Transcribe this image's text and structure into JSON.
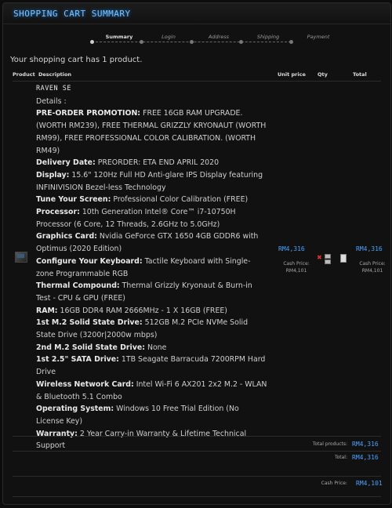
{
  "header": {
    "title": "SHOPPING CART SUMMARY"
  },
  "steps": [
    "Summary",
    "Login",
    "Address",
    "Shipping",
    "Payment"
  ],
  "cart_message": "Your shopping cart has 1 product.",
  "table_headers": {
    "product": "Product",
    "description": "Description",
    "unit_price": "Unit price",
    "qty": "Qty",
    "total": "Total"
  },
  "product": {
    "name": "RAVEN SE",
    "details_label": "Details :",
    "specs": [
      {
        "label": "PRE-ORDER PROMOTION:",
        "value": "FREE 16GB RAM UPGRADE. (WORTH RM239), FREE THERMAL GRIZZLY KRYONAUT (WORTH RM99), FREE PROFESSIONAL COLOR CALIBRATION. (WORTH RM49)"
      },
      {
        "label": "Delivery Date:",
        "value": "PREORDER: ETA END APRIL 2020"
      },
      {
        "label": "Display:",
        "value": "15.6\" 120Hz Full HD Anti-glare IPS Display featuring INFINIVISION Bezel-less Technology"
      },
      {
        "label": "Tune Your Screen:",
        "value": "Professional Color Calibration (FREE)"
      },
      {
        "label": "Processor:",
        "value": "10th Generation Intel® Core™ i7-10750H Processor (6 Core, 12 Threads, 2.6GHz to 5.0GHz)"
      },
      {
        "label": "Graphics Card:",
        "value": "Nvidia GeForce GTX 1650 4GB GDDR6 with Optimus (2020 Edition)"
      },
      {
        "label": "Configure Your Keyboard:",
        "value": "Tactile Keyboard with Single-zone Programmable RGB"
      },
      {
        "label": "Thermal Compound:",
        "value": "Thermal Grizzly Kryonaut & Burn-in Test - CPU & GPU (FREE)"
      },
      {
        "label": "RAM:",
        "value": "16GB DDR4 RAM 2666MHz - 1 X 16GB (FREE)"
      },
      {
        "label": "1st M.2 Solid State Drive:",
        "value": "512GB M.2 PCIe NVMe Solid State Drive (3200r|2000w mbps)"
      },
      {
        "label": "2nd M.2 Solid State Drive:",
        "value": "None"
      },
      {
        "label": "1st 2.5\" SATA Drive:",
        "value": "1TB Seagate Barracuda 7200RPM Hard Drive"
      },
      {
        "label": "Wireless Network Card:",
        "value": "Intel Wi-Fi 6 AX201 2x2 M.2 - WLAN & Bluetooth 5.1 Combo"
      },
      {
        "label": "Operating System:",
        "value": "Windows 10 Free Trial Edition (No License Key)"
      },
      {
        "label": "Warranty:",
        "value": "2 Year Carry-in Warranty & Lifetime Technical Support"
      }
    ],
    "unit_price": "RM4,316",
    "unit_cash_label": "Cash Price:",
    "unit_cash_price": "RM4,101",
    "total_price": "RM4,316",
    "total_cash_label": "Cash Price:",
    "total_cash_price": "RM4,101",
    "quantity": "1"
  },
  "totals": {
    "products_label": "Total products:",
    "products_value": "RM4,316",
    "total_label": "Total:",
    "total_value": "RM4,316",
    "cash_label": "Cash Price:",
    "cash_value": "RM4,101"
  },
  "icons": {
    "delete": "delete-icon",
    "increase": "increase-qty-icon",
    "decrease": "decrease-qty-icon"
  }
}
